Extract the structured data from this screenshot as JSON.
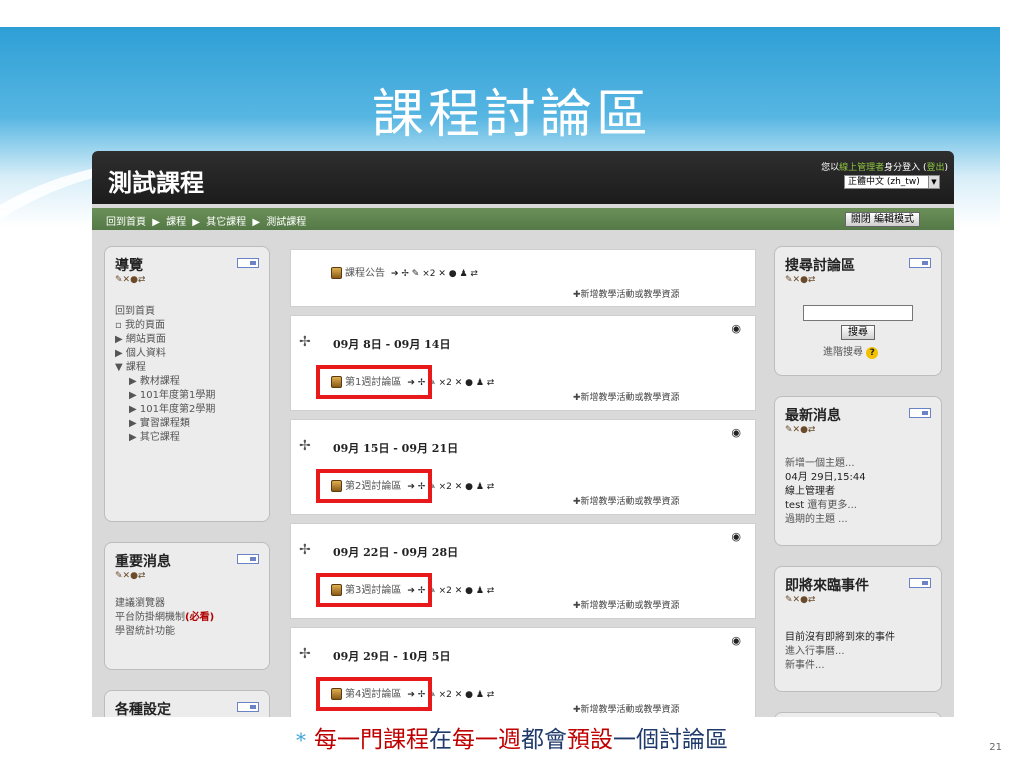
{
  "slide": {
    "title": "課程討論區",
    "caption_parts": [
      "每一門課程",
      "在",
      "每一週",
      "都會",
      "預設",
      "一個討論區"
    ],
    "page_number": "21"
  },
  "moodle": {
    "course_title": "測試課程",
    "login_text_prefix": "您以",
    "login_user": "線上管理者",
    "login_text_suffix": "身分登入 (",
    "logout": "登出",
    "login_text_end": ")",
    "language": "正體中文 (zh_tw)",
    "breadcrumbs": [
      "回到首頁",
      "課程",
      "其它課程",
      "測試課程"
    ],
    "edit_button": "關閉 編輯模式",
    "left_blocks": {
      "navigation": {
        "title": "導覽",
        "items": [
          "回到首頁",
          "我的頁面",
          "網站頁面",
          "個人資料",
          "課程",
          "教材課程",
          "101年度第1學期",
          "101年度第2學期",
          "實習課程類",
          "其它課程"
        ]
      },
      "important": {
        "title": "重要消息",
        "lines": [
          "建議瀏覽器",
          "平台防掛網機制",
          "(必看)",
          "學習統計功能"
        ]
      },
      "settings": {
        "title": "各種設定"
      }
    },
    "right_blocks": {
      "search": {
        "title": "搜尋討論區",
        "button": "搜尋",
        "advanced": "進階搜尋"
      },
      "news": {
        "title": "最新消息",
        "lines": [
          "新增一個主題...",
          "04月 29日,15:44",
          "線上管理者",
          "test",
          "還有更多...",
          "過期的主題 ..."
        ]
      },
      "events": {
        "title": "即將來臨事件",
        "lines": [
          "目前沒有即將到來的事件",
          "進入行事曆...",
          "新事件..."
        ]
      }
    },
    "sections": [
      {
        "title": "",
        "forum": "課程公告",
        "add": "✚新增教學活動或教學資源"
      },
      {
        "title": "09月 8日 - 09月 14日",
        "forum": "第1週討論區",
        "add": "✚新增教學活動或教學資源"
      },
      {
        "title": "09月 15日 - 09月 21日",
        "forum": "第2週討論區",
        "add": "✚新增教學活動或教學資源"
      },
      {
        "title": "09月 22日 - 09月 28日",
        "forum": "第3週討論區",
        "add": "✚新增教學活動或教學資源"
      },
      {
        "title": "09月 29日 - 10月 5日",
        "forum": "第4週討論區",
        "add": "✚新增教學活動或教學資源"
      }
    ],
    "edit_tools": "➔ ✢ ✎ ×2 ✕ ● ♟ ⇄",
    "block_tools": "✎✕●⇄"
  },
  "colors": {
    "highlight_box": "#e8191b",
    "nav_bar": "#5f8550",
    "header": "#1f1f1f"
  }
}
